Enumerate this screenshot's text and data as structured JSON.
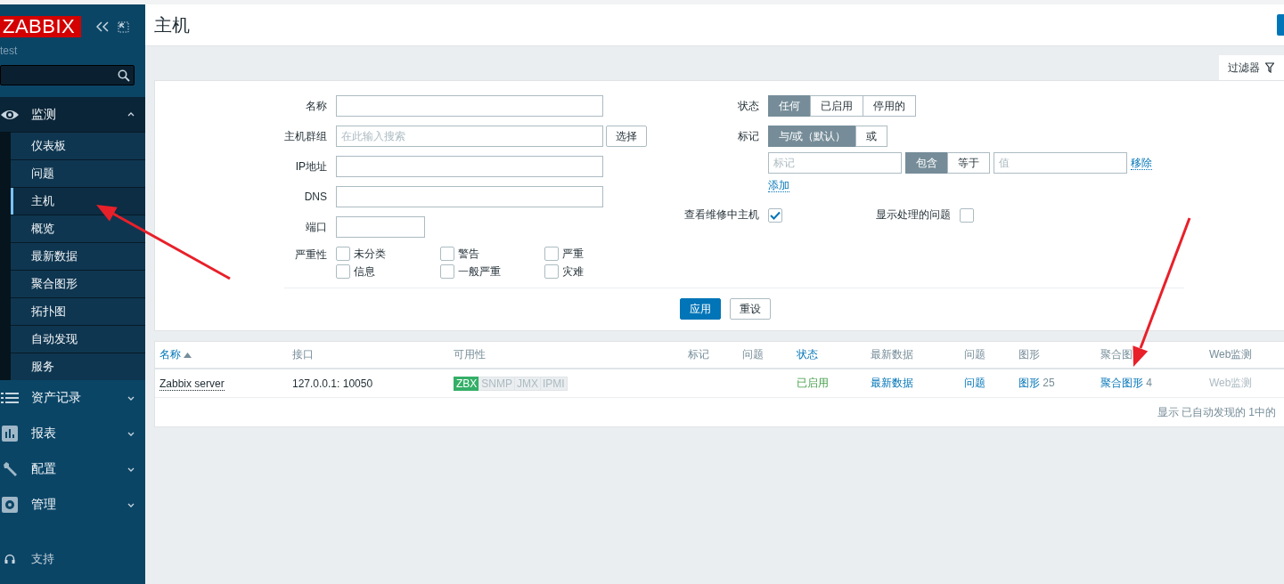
{
  "sidebar": {
    "logo": "ZABBIX",
    "user": "test",
    "menu": [
      {
        "label": "监测",
        "expanded": true,
        "children": [
          {
            "label": "仪表板",
            "selected": false
          },
          {
            "label": "问题",
            "selected": false
          },
          {
            "label": "主机",
            "selected": true
          },
          {
            "label": "概览",
            "selected": false
          },
          {
            "label": "最新数据",
            "selected": false
          },
          {
            "label": "聚合图形",
            "selected": false
          },
          {
            "label": "拓扑图",
            "selected": false
          },
          {
            "label": "自动发现",
            "selected": false
          },
          {
            "label": "服务",
            "selected": false
          }
        ]
      },
      {
        "label": "资产记录",
        "expanded": false
      },
      {
        "label": "报表",
        "expanded": false
      },
      {
        "label": "配置",
        "expanded": false
      },
      {
        "label": "管理",
        "expanded": false
      }
    ],
    "support": {
      "label": "支持"
    }
  },
  "header": {
    "title": "主机"
  },
  "filter_tab": {
    "label": "过滤器"
  },
  "filter": {
    "fields": [
      {
        "label": "名称",
        "kind": "wide"
      },
      {
        "label": "主机群组",
        "kind": "multiselect",
        "placeholder": "在此输入搜索",
        "button": "选择"
      },
      {
        "label": "IP地址",
        "kind": "wide"
      },
      {
        "label": "DNS",
        "kind": "wide"
      },
      {
        "label": "端口",
        "kind": "short"
      }
    ],
    "severity": {
      "label": "严重性",
      "options": [
        {
          "label": "未分类",
          "checked": false
        },
        {
          "label": "警告",
          "checked": false
        },
        {
          "label": "严重",
          "checked": false
        },
        {
          "label": "信息",
          "checked": false
        },
        {
          "label": "一般严重",
          "checked": false
        },
        {
          "label": "灾难",
          "checked": false
        }
      ]
    },
    "status": {
      "label": "状态",
      "options": [
        {
          "label": "任何",
          "selected": true
        },
        {
          "label": "已启用",
          "selected": false
        },
        {
          "label": "停用的",
          "selected": false
        }
      ]
    },
    "tags": {
      "label": "标记",
      "operators": [
        {
          "label": "与/或（默认）",
          "selected": true
        },
        {
          "label": "或",
          "selected": false
        }
      ],
      "rows": [
        {
          "tag_placeholder": "标记",
          "match": [
            {
              "label": "包含",
              "selected": true
            },
            {
              "label": "等于",
              "selected": false
            }
          ],
          "value_placeholder": "值",
          "remove": "移除"
        }
      ],
      "add": "添加"
    },
    "maintenance": {
      "label": "查看维修中主机",
      "checked": true
    },
    "suppressed": {
      "label": "显示处理的问题",
      "checked": false
    },
    "apply": "应用",
    "reset": "重设"
  },
  "table": {
    "columns": [
      {
        "label": "名称",
        "sortable": true,
        "sorted_ascending": true
      },
      {
        "label": "接口",
        "sortable": false
      },
      {
        "label": "可用性",
        "sortable": false
      },
      {
        "label": "标记",
        "sortable": false
      },
      {
        "label": "问题",
        "sortable": false
      },
      {
        "label": "状态",
        "sortable": true
      },
      {
        "label": "最新数据",
        "sortable": false
      },
      {
        "label": "问题",
        "sortable": false
      },
      {
        "label": "图形",
        "sortable": false
      },
      {
        "label": "聚合图",
        "sortable": false
      },
      {
        "label": "Web监测",
        "sortable": false
      }
    ],
    "rows": [
      {
        "cells": [
          {
            "kind": "menu-link",
            "text": "Zabbix server"
          },
          {
            "kind": "text",
            "text": "127.0.0.1: 10050"
          },
          {
            "kind": "availability",
            "badges": [
              {
                "label": "ZBX",
                "available": true
              },
              {
                "label": "SNMP",
                "available": false
              },
              {
                "label": "JMX",
                "available": false
              },
              {
                "label": "IPMI",
                "available": false
              }
            ]
          },
          {
            "kind": "blank"
          },
          {
            "kind": "blank"
          },
          {
            "kind": "status",
            "text": "已启用",
            "enabled": true
          },
          {
            "kind": "link",
            "text": "最新数据"
          },
          {
            "kind": "link",
            "text": "问题"
          },
          {
            "kind": "count-link",
            "text": "图形",
            "count": "25"
          },
          {
            "kind": "count-link",
            "text": "聚合图形",
            "count": "4"
          },
          {
            "kind": "disabled",
            "text": "Web监测"
          }
        ]
      }
    ],
    "footer": "显示 已自动发现的 1中的"
  }
}
